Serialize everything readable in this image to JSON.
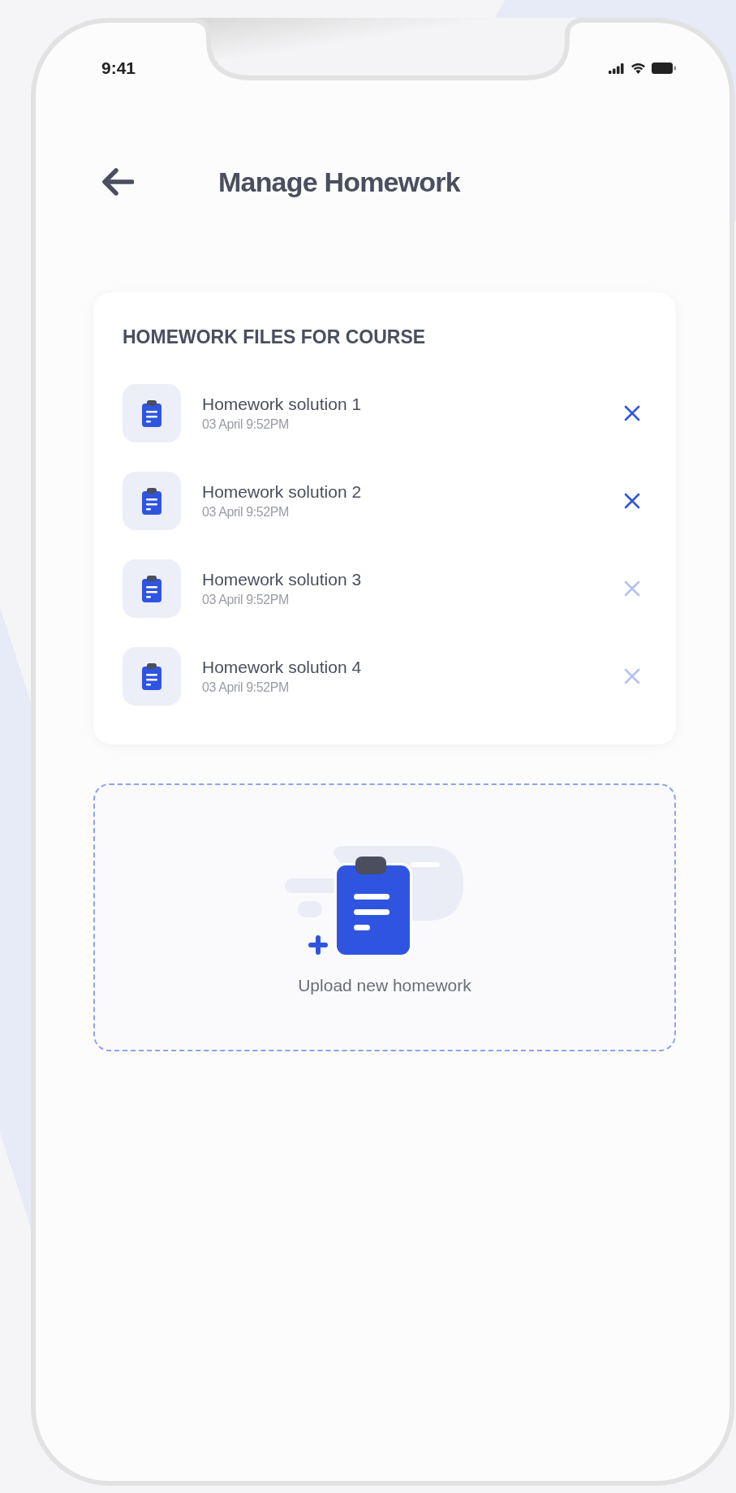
{
  "status_bar": {
    "time": "9:41"
  },
  "header": {
    "title": "Manage Homework"
  },
  "files_card": {
    "heading": "HOMEWORK FILES FOR COURSE",
    "files": [
      {
        "name": "Homework solution 1",
        "date": "03 April 9:52PM",
        "remove_disabled": false
      },
      {
        "name": "Homework solution 2",
        "date": "03 April 9:52PM",
        "remove_disabled": false
      },
      {
        "name": "Homework solution 3",
        "date": "03 April 9:52PM",
        "remove_disabled": true
      },
      {
        "name": "Homework solution 4",
        "date": "03 April 9:52PM",
        "remove_disabled": true
      }
    ]
  },
  "upload": {
    "label": "Upload new homework"
  }
}
